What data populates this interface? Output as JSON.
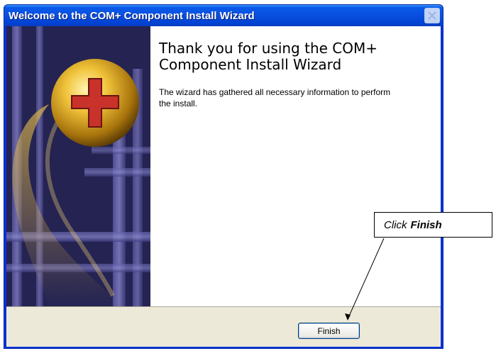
{
  "window": {
    "title": "Welcome to the COM+ Component Install Wizard"
  },
  "content": {
    "heading": "Thank you for using the COM+ Component Install Wizard",
    "body": "The wizard has gathered all necessary information to perform the install."
  },
  "buttons": {
    "finish_label": "Finish",
    "close_icon": "close-icon"
  },
  "callout": {
    "prefix": "Click",
    "emphasis": "Finish"
  },
  "colors": {
    "titlebar": "#0a4fdf",
    "window_border": "#0831d9",
    "dialog_background": "#ece9d8",
    "banner_dark": "#2b2a5e",
    "ball_gold": "#e8b520",
    "plus_red": "#c8322a"
  }
}
